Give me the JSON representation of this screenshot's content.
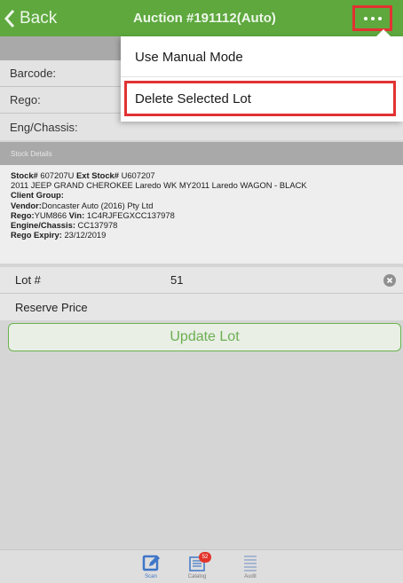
{
  "navbar": {
    "back_label": "Back",
    "title": "Auction #191112(Auto)"
  },
  "form": {
    "fields": [
      {
        "label": "Barcode:"
      },
      {
        "label": "Rego:"
      },
      {
        "label": "Eng/Chassis:"
      }
    ]
  },
  "stock": {
    "section_title": "Stock Details",
    "stock_label": "Stock#",
    "stock_value": "607207U",
    "ext_stock_label": "Ext Stock#",
    "ext_stock_value": "U607207",
    "description": "2011 JEEP GRAND CHEROKEE Laredo WK MY2011 Laredo WAGON - BLACK",
    "client_group_label": "Client Group:",
    "client_group_value": "",
    "vendor_label": "Vendor:",
    "vendor_value": "Doncaster Auto (2016) Pty Ltd",
    "rego_label": "Rego:",
    "rego_value": "YUM866",
    "vin_label": "Vin:",
    "vin_value": "1C4RJFEGXCC137978",
    "engine_label": "Engine/Chassis:",
    "engine_value": "CC137978",
    "rego_expiry_label": "Rego Expiry:",
    "rego_expiry_value": "23/12/2019"
  },
  "lot": {
    "label": "Lot #",
    "value": "51"
  },
  "reserve": {
    "label": "Reserve Price"
  },
  "update_button": "Update Lot",
  "menu": {
    "items": [
      {
        "label": "Use Manual Mode"
      },
      {
        "label": "Delete Selected Lot"
      }
    ]
  },
  "tabbar": {
    "tabs": [
      {
        "label": "Scan",
        "icon": "edit-icon"
      },
      {
        "label": "Catalog",
        "icon": "catalog-icon",
        "badge": "52"
      },
      {
        "label": "Audit",
        "icon": "list-icon"
      }
    ]
  },
  "colors": {
    "navbar": "#5ea83e",
    "highlight": "#e23232",
    "accent_blue": "#3f76c8"
  }
}
